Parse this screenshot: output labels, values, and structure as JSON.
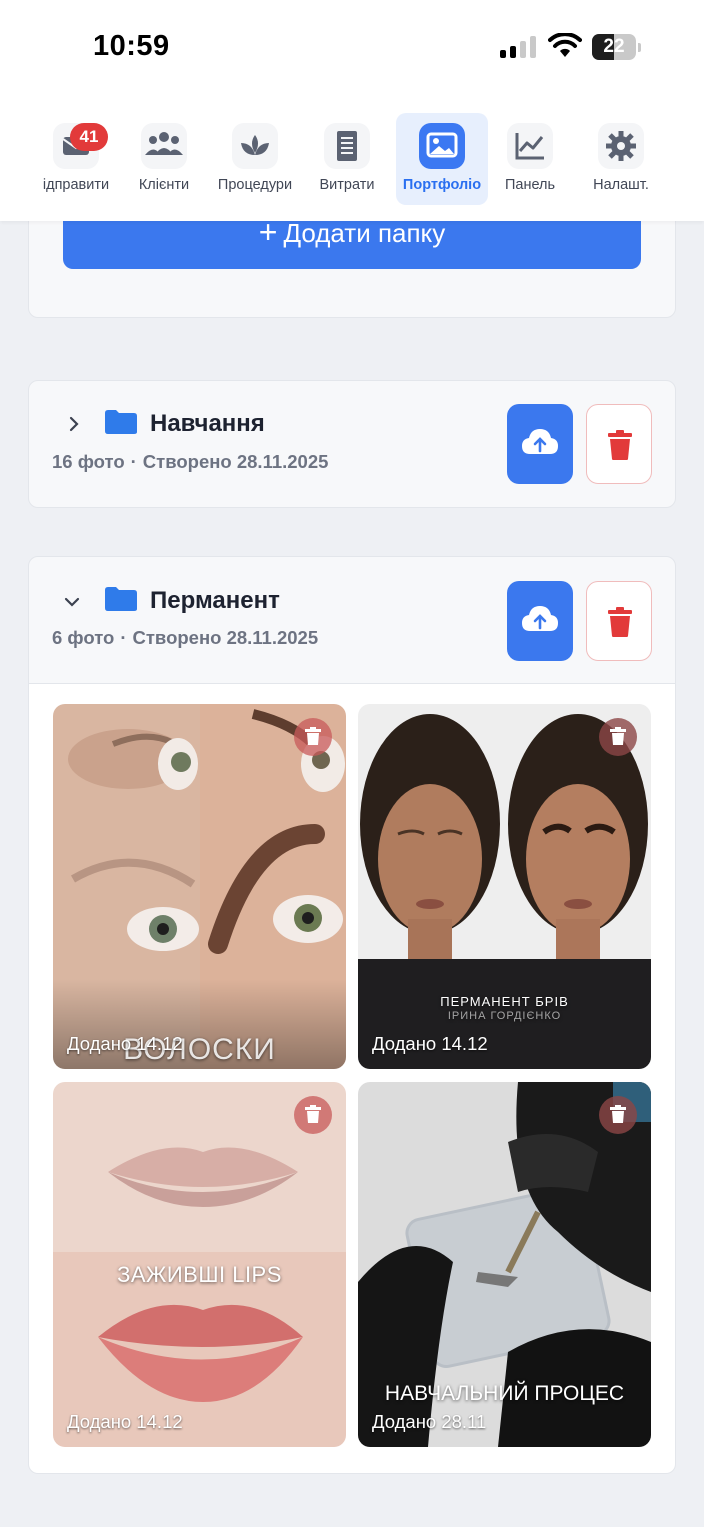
{
  "status_bar": {
    "time": "10:59",
    "battery": "22"
  },
  "nav": {
    "items": [
      {
        "label": "ідправити",
        "icon": "send-mail-icon"
      },
      {
        "label": "Клієнти",
        "icon": "clients-icon"
      },
      {
        "label": "Процедури",
        "icon": "lotus-icon"
      },
      {
        "label": "Витрати",
        "icon": "receipt-icon"
      },
      {
        "label": "Портфоліо",
        "icon": "gallery-icon",
        "active": true
      },
      {
        "label": "Панель",
        "icon": "chart-icon"
      },
      {
        "label": "Налашт.",
        "icon": "gear-icon"
      }
    ],
    "badge": "41"
  },
  "add_folder": {
    "label": "Додати папку"
  },
  "folders": [
    {
      "name": "Навчання",
      "count": "16 фото",
      "created": "Створено 28.11.2025",
      "expanded": false
    },
    {
      "name": "Перманент",
      "count": "6 фото",
      "created": "Створено 28.11.2025",
      "expanded": true
    }
  ],
  "photos": [
    {
      "added": "Додано 14.12",
      "overlay": "ВОЛОСКИ"
    },
    {
      "added": "Додано 14.12",
      "overlay": "ПЕРМАНЕНТ БРІВ",
      "overlay_sub": "ІРИНА ГОРДІЄНКО"
    },
    {
      "added": "Додано 14.12",
      "overlay": "ЗАЖИВШІ LIPS"
    },
    {
      "added": "Додано 28.11",
      "overlay": "НАВЧАЛЬНИЙ ПРОЦЕС"
    }
  ],
  "colors": {
    "accent": "#3b78ee",
    "danger": "#e23a3a",
    "background": "#eef0f4"
  }
}
